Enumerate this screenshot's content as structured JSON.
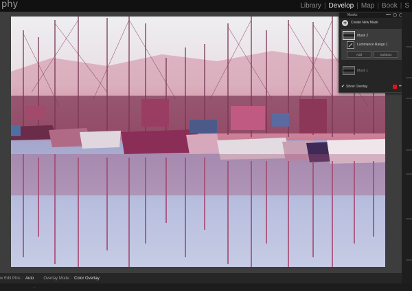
{
  "topbar": {
    "brand": "phy",
    "modules": [
      {
        "label": "Library",
        "active": false
      },
      {
        "label": "Develop",
        "active": true
      },
      {
        "label": "Map",
        "active": false
      },
      {
        "label": "Book",
        "active": false
      },
      {
        "label": "S",
        "active": false
      }
    ]
  },
  "masks_panel": {
    "title": "Masks",
    "create_label": "Create New Mask",
    "mask1": {
      "name": "Mask 2",
      "component": "Luminance Range 1",
      "add_label": "Add",
      "subtract_label": "Subtract"
    },
    "mask2": {
      "name": "Mask 1"
    },
    "show_overlay_label": "Show Overlay",
    "overlay_color": "#e0141e"
  },
  "bottombar": {
    "edit_pins_label": "w Edit Pins :",
    "edit_pins_value": "Auto",
    "overlay_mode_label": "Overlay Mode :",
    "overlay_mode_value": "Color Overlay"
  },
  "filmstrip": {
    "text": "..."
  },
  "colors": {
    "accent_overlay": "#c2506e",
    "app_bg": "#3d3d3d"
  },
  "icons": [
    "plus-icon",
    "gear-icon",
    "close-icon",
    "mask-thumbnail-icon",
    "luminance-range-icon",
    "checkmark-icon",
    "more-options-icon"
  ]
}
